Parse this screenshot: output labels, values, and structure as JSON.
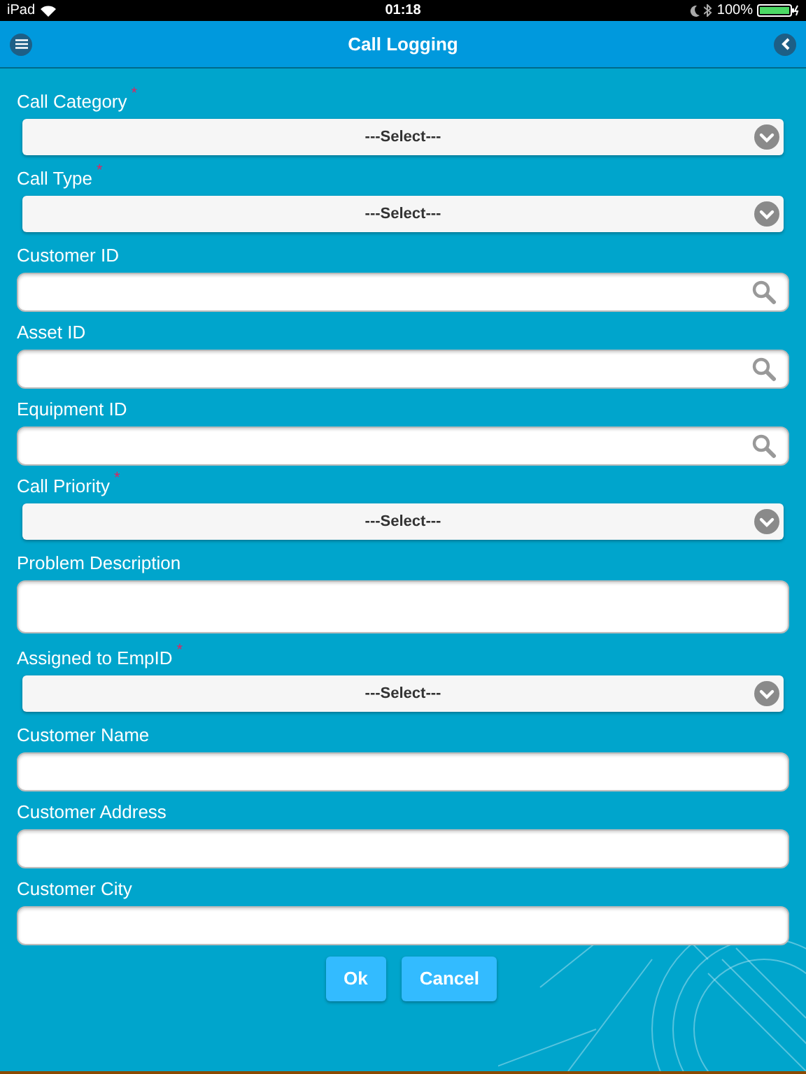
{
  "status_bar": {
    "device": "iPad",
    "time": "01:18",
    "battery": "100%"
  },
  "header": {
    "title": "Call Logging"
  },
  "fields": [
    {
      "kind": "select",
      "label": "Call Category",
      "mark": "*",
      "value": "---Select---"
    },
    {
      "kind": "select",
      "label": "Call Type",
      "mark": "*",
      "value": "---Select---"
    },
    {
      "kind": "search",
      "label": "Customer ID"
    },
    {
      "kind": "search",
      "label": "Asset ID"
    },
    {
      "kind": "search",
      "label": "Equipment ID"
    },
    {
      "kind": "select",
      "label": "Call Priority",
      "mark": "*",
      "value": "---Select---"
    },
    {
      "kind": "textarea",
      "label": "Problem Description"
    },
    {
      "kind": "select",
      "label": "Assigned to EmpID",
      "mark": "*",
      "value": "---Select---"
    },
    {
      "kind": "text",
      "label": "Customer Name"
    },
    {
      "kind": "text",
      "label": "Customer Address"
    },
    {
      "kind": "text",
      "label": "Customer City"
    }
  ],
  "buttons": [
    "Ok",
    "Cancel"
  ]
}
